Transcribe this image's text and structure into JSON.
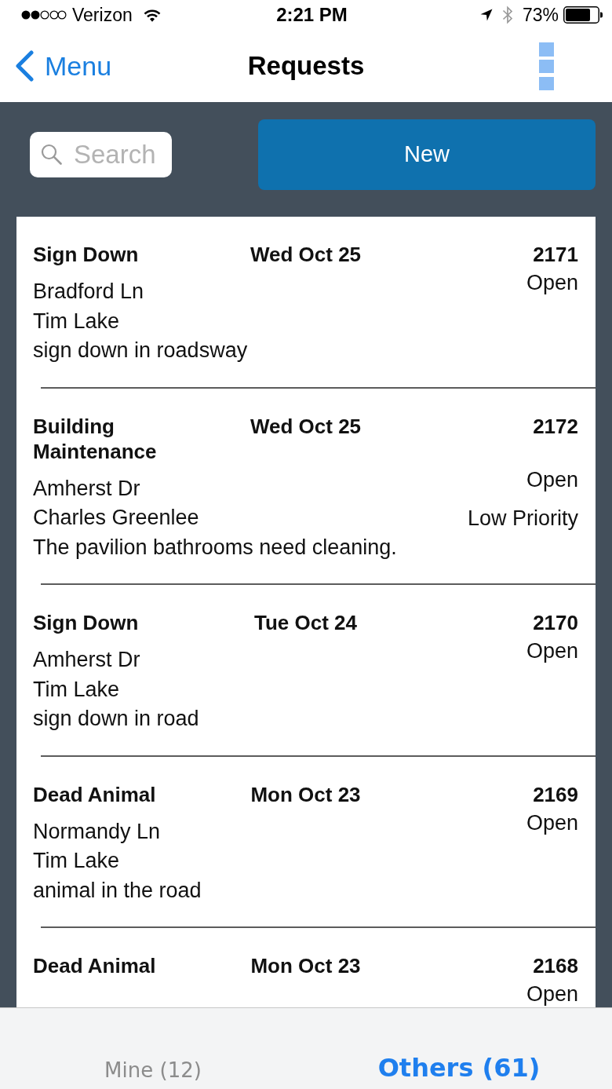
{
  "status_bar": {
    "carrier": "Verizon",
    "time": "2:21 PM",
    "battery": "73%"
  },
  "nav_bar": {
    "back": "Menu",
    "title": "Requests"
  },
  "toolbar": {
    "search": {
      "placeholder": "Search"
    },
    "new_button": "New"
  },
  "requests": [
    {
      "title": "Sign Down",
      "date": "Wed Oct 25",
      "number": "2171",
      "status": "Open",
      "address": "Bradford Ln",
      "person": "Tim Lake",
      "description": "sign down in roadsway"
    },
    {
      "title": "Building Maintenance",
      "date": "Wed Oct 25",
      "number": "2172",
      "status": "Open",
      "priority": "Low Priority",
      "address": "Amherst Dr",
      "person": "Charles Greenlee",
      "description": "The pavilion bathrooms need cleaning."
    },
    {
      "title": "Sign Down",
      "date": "Tue Oct 24",
      "number": "2170",
      "status": "Open",
      "address": "Amherst Dr",
      "person": "Tim Lake",
      "description": "sign down in road"
    },
    {
      "title": "Dead Animal",
      "date": "Mon Oct 23",
      "number": "2169",
      "status": "Open",
      "address": "Normandy Ln",
      "person": "Tim Lake",
      "description": "animal in the road"
    },
    {
      "title": "Dead Animal",
      "date": "Mon Oct 23",
      "number": "2168",
      "status": "Open"
    }
  ],
  "tabs": [
    {
      "label": "Mine (12)",
      "selected": false
    },
    {
      "label": "Others (61)",
      "selected": true
    }
  ]
}
